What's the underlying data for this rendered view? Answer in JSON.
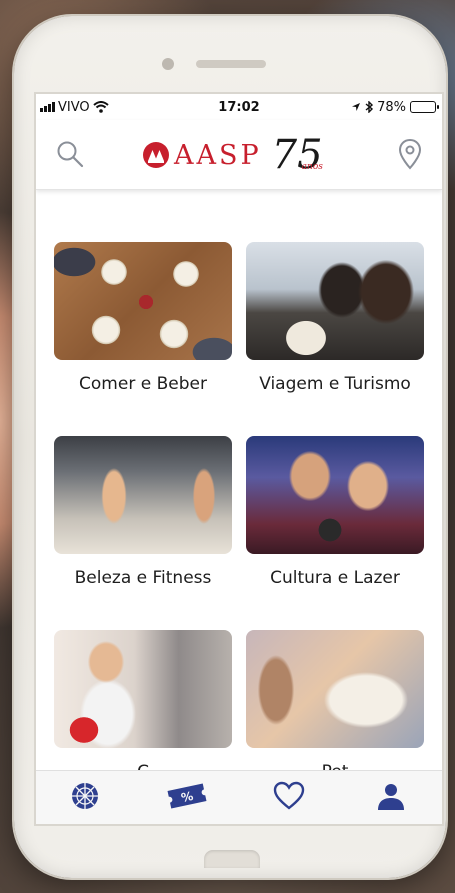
{
  "status_bar": {
    "carrier": "VIVO",
    "time": "17:02",
    "battery": "78%",
    "battery_level": 0.78,
    "battery_color": "#f2c81a"
  },
  "header": {
    "search_icon": "search-icon",
    "brand_text": "AASP",
    "brand_number": "75",
    "brand_anos": "anos",
    "brand_color": "#c71f2d",
    "location_icon": "map-pin-icon"
  },
  "categories": [
    {
      "label": "Comer e Beber"
    },
    {
      "label": "Viagem e Turismo"
    },
    {
      "label": "Beleza e Fitness"
    },
    {
      "label": "Cultura e Lazer"
    },
    {
      "label": "C"
    },
    {
      "label": "Pet"
    }
  ],
  "bottom_nav": {
    "accent_color": "#2e3f8f",
    "items": [
      {
        "icon": "umbrella-icon"
      },
      {
        "icon": "ticket-percent-icon"
      },
      {
        "icon": "heart-icon"
      },
      {
        "icon": "user-icon"
      }
    ]
  }
}
